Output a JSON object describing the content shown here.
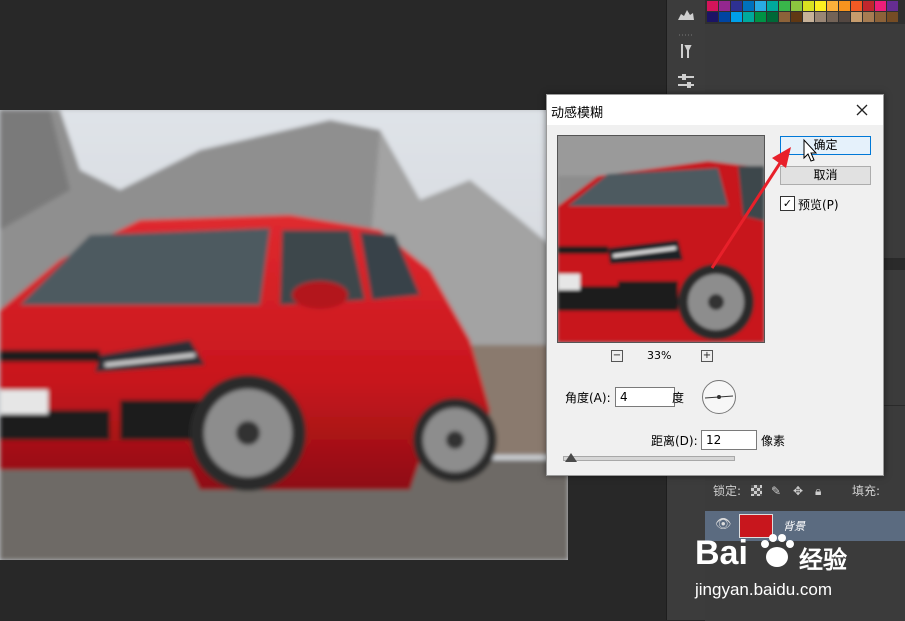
{
  "dialog": {
    "title": "动感模糊",
    "close_icon": "close-icon",
    "ok_label": "确定",
    "cancel_label": "取消",
    "preview_checked": true,
    "preview_check_glyph": "✓",
    "preview_label": "预览(P)",
    "zoom_out_glyph": "−",
    "zoom_in_glyph": "+",
    "zoom_level": "33%",
    "angle_label": "角度(A):",
    "angle_value": "4",
    "angle_unit": "度",
    "distance_label": "距离(D):",
    "distance_value": "12",
    "distance_unit": "像素"
  },
  "layers": {
    "lock_label": "锁定:",
    "fill_label": "填充:",
    "layer_name": "背景",
    "lock_icons": [
      "checkerboard-icon",
      "brush-icon",
      "move-icon",
      "lock-icon"
    ]
  },
  "watermark": {
    "brand": "Bai",
    "brand_suffix": "经验",
    "url": "jingyan.baidu.com"
  },
  "colors": {
    "app_bg": "#282828",
    "car_red": "#c8161d",
    "accent_blue": "#0078d7",
    "annotation_red": "#e8202a"
  },
  "swatches": [
    "#d4145a",
    "#93278f",
    "#2e3192",
    "#0071bc",
    "#29abe2",
    "#00a99d",
    "#39b54a",
    "#8cc63f",
    "#d9e021",
    "#fcee21",
    "#fbb03b",
    "#f7931e",
    "#f15a24",
    "#c1272d",
    "#ed1e79",
    "#662d91",
    "#1b1464",
    "#0045a2",
    "#00a0e9",
    "#00a99d",
    "#009245",
    "#006837",
    "#8c6239",
    "#603813",
    "#c7b299",
    "#998675",
    "#736357",
    "#534741",
    "#c69c6d",
    "#a67c52",
    "#8c6239",
    "#754c24"
  ],
  "dock_icons": [
    "histogram-icon",
    "dots-icon",
    "tools-icon",
    "sliders-icon"
  ]
}
